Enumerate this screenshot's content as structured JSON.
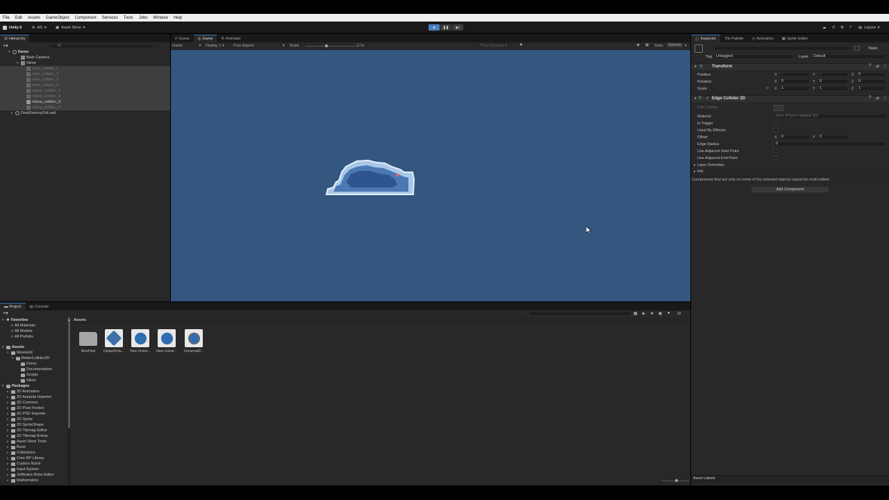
{
  "menu": [
    "File",
    "Edit",
    "Assets",
    "GameObject",
    "Component",
    "Services",
    "Tools",
    "Jobs",
    "Window",
    "Help"
  ],
  "toolbar": {
    "account": "Unity 6",
    "user": "AS",
    "asset_store": "Asset Store",
    "layout": "Layout"
  },
  "hierarchy": {
    "tab": "Hierarchy",
    "search_placeholder": "All",
    "items": [
      {
        "label": "Demo"
      },
      {
        "label": "Main Camera"
      },
      {
        "label": "Slime"
      },
      {
        "label": "mlns_collider_1"
      },
      {
        "label": "mlns_collider_2"
      },
      {
        "label": "mlns_collider_3"
      },
      {
        "label": "mlns_collider_4"
      },
      {
        "label": "mlsoa_collider_2"
      },
      {
        "label": "mlsok_collider_3"
      },
      {
        "label": "mlsoa_collider_5"
      },
      {
        "label": "mlsoa_collider_6"
      },
      {
        "label": "DontDestroyOnLoad"
      }
    ]
  },
  "scene": {
    "tabs": [
      "Scene",
      "Game",
      "Animator"
    ],
    "game_dropdown": "Game",
    "display": "Display 1",
    "aspect": "Free Aspect",
    "scale_label": "Scale",
    "scale_value": "2.1x",
    "play_focused": "Play Focused",
    "stats": "Stats",
    "gizmos": "Gizmos",
    "bg_color": "#33577f"
  },
  "inspector": {
    "tabs": [
      "Inspector",
      "Tile Palette",
      "Animation",
      "Sprite Editor"
    ],
    "static": "Static",
    "tag_label": "Tag",
    "tag_value": "Untagged",
    "layer_label": "Layer",
    "layer_value": "Default",
    "transform": {
      "title": "Transform",
      "rows": [
        {
          "label": "Position",
          "x": "-",
          "y": "-",
          "z": "0"
        },
        {
          "label": "Rotation",
          "x": "0",
          "y": "0",
          "z": "0"
        },
        {
          "label": "Scale",
          "x": "1",
          "y": "1",
          "z": "1"
        }
      ]
    },
    "edge": {
      "title": "Edge Collider 2D",
      "edit_label": "Edit Collider",
      "material_label": "Material",
      "material_value": "None (Physics Material 2D)",
      "is_trigger": "Is Trigger",
      "used_by_effector": "Used By Effector",
      "offset_label": "Offset",
      "offset_x": "0",
      "offset_y": "0",
      "edge_radius_label": "Edge Radius",
      "edge_radius_value": "0",
      "adj_start": "Use Adjacent Start Point",
      "adj_end": "Use Adjacent End Point",
      "layer_overrides": "Layer Overrides",
      "info": "Info"
    },
    "note": "Components that are only on some of the selected objects cannot be multi-edited.",
    "add_component": "Add Component",
    "asset_labels": "Asset Labels"
  },
  "project": {
    "tabs": [
      "Project",
      "Console"
    ],
    "favorites": {
      "label": "Favorites",
      "items": [
        "All Materials",
        "All Models",
        "All Prefabs"
      ]
    },
    "assets": {
      "label": "Assets",
      "tree": [
        "NineHold",
        "BetterCollider2D",
        "Demo",
        "Documentation",
        "Scripts",
        "Slime"
      ]
    },
    "packages": {
      "label": "Packages",
      "items": [
        "2D Animation",
        "2D Aseprite Importer",
        "2D Common",
        "2D Pixel Perfect",
        "2D PSD Importer",
        "2D Sprite",
        "2D SpriteShape",
        "2D Tilemap Editor",
        "2D Tilemap Extras",
        "Asset Store Tools",
        "Burst",
        "Collections",
        "Core RP Library",
        "Custom NUnit",
        "Input System",
        "JetBrains Rider Editor",
        "Mathematics"
      ]
    },
    "breadcrumb": "Assets",
    "grid": [
      {
        "label": "NineHold"
      },
      {
        "label": "DefaultVolu..."
      },
      {
        "label": "New Univer..."
      },
      {
        "label": "New Univer..."
      },
      {
        "label": "UniversalR..."
      }
    ],
    "count": "32"
  }
}
